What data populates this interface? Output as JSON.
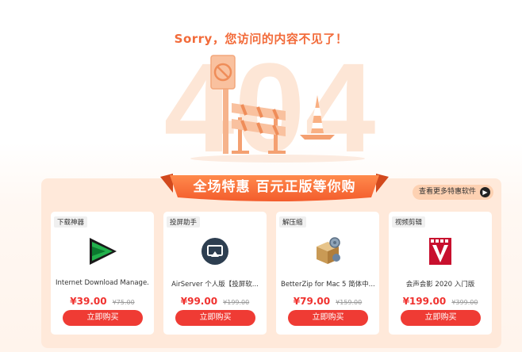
{
  "error": {
    "title": "Sorry，您访问的内容不见了！",
    "code_graphic": "404"
  },
  "promo": {
    "banner_title": "全场特惠 百元正版等你购",
    "more_link": "查看更多特惠软件",
    "products": [
      {
        "category": "下载神器",
        "name": "Internet Download Manage...",
        "price": "¥39.00",
        "original_price": "¥75.00",
        "buy_label": "立即购买",
        "icon": "idm-download-icon"
      },
      {
        "category": "投屏助手",
        "name": "AirServer 个人版【投屏软...",
        "price": "¥99.00",
        "original_price": "¥199.00",
        "buy_label": "立即购买",
        "icon": "airserver-cast-icon"
      },
      {
        "category": "解压缩",
        "name": "BetterZip for Mac 5 简体中...",
        "price": "¥79.00",
        "original_price": "¥159.00",
        "buy_label": "立即购买",
        "icon": "betterzip-box-icon"
      },
      {
        "category": "视频剪辑",
        "name": "会声会影 2020 入门版",
        "price": "¥199.00",
        "original_price": "¥399.00",
        "buy_label": "立即购买",
        "icon": "videostudio-film-icon"
      }
    ]
  },
  "colors": {
    "accent": "#f26b3a",
    "price": "#f0322f",
    "button": "#ef3b34",
    "panel": "#ffe9da"
  }
}
